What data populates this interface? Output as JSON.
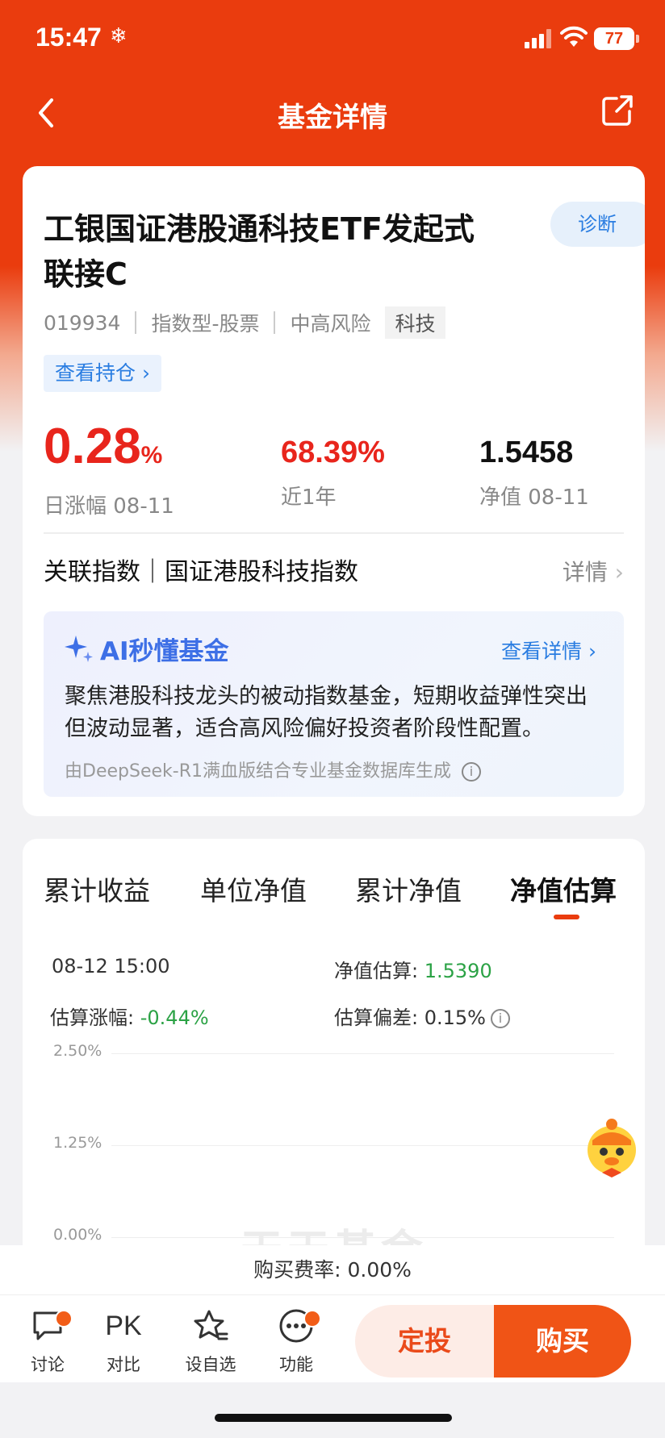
{
  "status": {
    "time": "15:47",
    "battery": "77"
  },
  "nav": {
    "title": "基金详情"
  },
  "fund": {
    "name": "工银国证港股通科技ETF发起式联接C",
    "diagnose_label": "诊断",
    "code": "019934",
    "type": "指数型-股票",
    "risk": "中高风险",
    "tag": "科技",
    "holdings_label": "查看持仓"
  },
  "stats": {
    "daily_change": "0.28",
    "daily_change_unit": "%",
    "daily_change_label": "日涨幅 08-11",
    "one_year": "68.39%",
    "one_year_label": "近1年",
    "nav": "1.5458",
    "nav_label": "净值 08-11"
  },
  "index": {
    "label": "关联指数｜国证港股科技指数",
    "detail": "详情"
  },
  "ai": {
    "title": "AI秒懂基金",
    "more": "查看详情",
    "text": "聚焦港股科技龙头的被动指数基金，短期收益弹性突出但波动显著，适合高风险偏好投资者阶段性配置。",
    "source": "由DeepSeek-R1满血版结合专业基金数据库生成"
  },
  "tabs": [
    "累计收益",
    "单位净值",
    "累计净值",
    "净值估算"
  ],
  "estimate": {
    "time": "08-12 15:00",
    "value_label": "净值估算:",
    "value": "1.5390",
    "change_label": "估算涨幅:",
    "change": "-0.44%",
    "deviation_label": "估算偏差:",
    "deviation": "0.15%"
  },
  "chart_data": {
    "type": "line",
    "title": "",
    "xlabel": "",
    "ylabel": "",
    "y_ticks": [
      "2.50%",
      "1.25%",
      "0.00%"
    ],
    "ylim": [
      0,
      2.5
    ],
    "series": []
  },
  "watermark": "天天基金",
  "fee": {
    "label": "购买费率: 0.00%"
  },
  "bottom": {
    "tools": [
      "讨论",
      "对比",
      "设自选",
      "功能"
    ],
    "pk": "PK",
    "dingtou": "定投",
    "buy": "购买"
  }
}
